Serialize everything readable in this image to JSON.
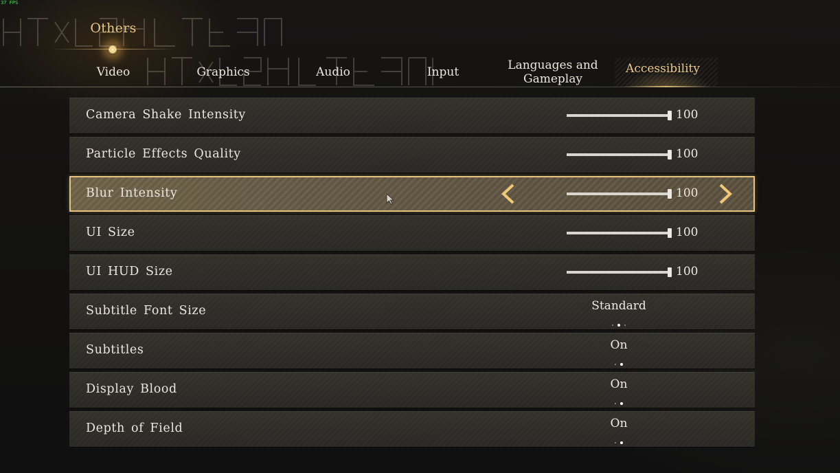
{
  "fps_counter": "37 FPS",
  "header": {
    "section_title": "Others",
    "tabs": [
      {
        "label": "Video"
      },
      {
        "label": "Graphics"
      },
      {
        "label": "Audio"
      },
      {
        "label": "Input"
      },
      {
        "label_line1": "Languages and",
        "label_line2": "Gameplay"
      },
      {
        "label": "Accessibility"
      }
    ],
    "active_tab": "Accessibility"
  },
  "settings": [
    {
      "label": "Camera Shake Intensity",
      "type": "slider",
      "value": "100",
      "level": 1.0
    },
    {
      "label": "Particle Effects Quality",
      "type": "slider",
      "value": "100",
      "level": 1.0
    },
    {
      "label": "Blur Intensity",
      "type": "slider",
      "value": "100",
      "level": 1.0,
      "selected": true
    },
    {
      "label": "UI Size",
      "type": "slider",
      "value": "100",
      "level": 1.0
    },
    {
      "label": "UI HUD Size",
      "type": "slider",
      "value": "100",
      "level": 1.0
    },
    {
      "label": "Subtitle Font Size",
      "type": "option",
      "value": "Standard",
      "option_count": 3,
      "option_index": 1
    },
    {
      "label": "Subtitles",
      "type": "option",
      "value": "On",
      "option_count": 2,
      "option_index": 1
    },
    {
      "label": "Display Blood",
      "type": "option",
      "value": "On",
      "option_count": 2,
      "option_index": 1
    },
    {
      "label": "Depth of Field",
      "type": "option",
      "value": "On",
      "option_count": 2,
      "option_index": 1
    }
  ],
  "colors": {
    "accent_gold": "#e6c47f",
    "active_tab_text": "#eac88b",
    "row_bg": "#2e2b27",
    "selected_row_bg": "#5e5440"
  },
  "icons": {
    "prev_arrow": "chevron-left-icon",
    "next_arrow": "chevron-right-icon",
    "cursor": "mouse-cursor-icon",
    "tab_marker": "glowing-orb-icon"
  }
}
